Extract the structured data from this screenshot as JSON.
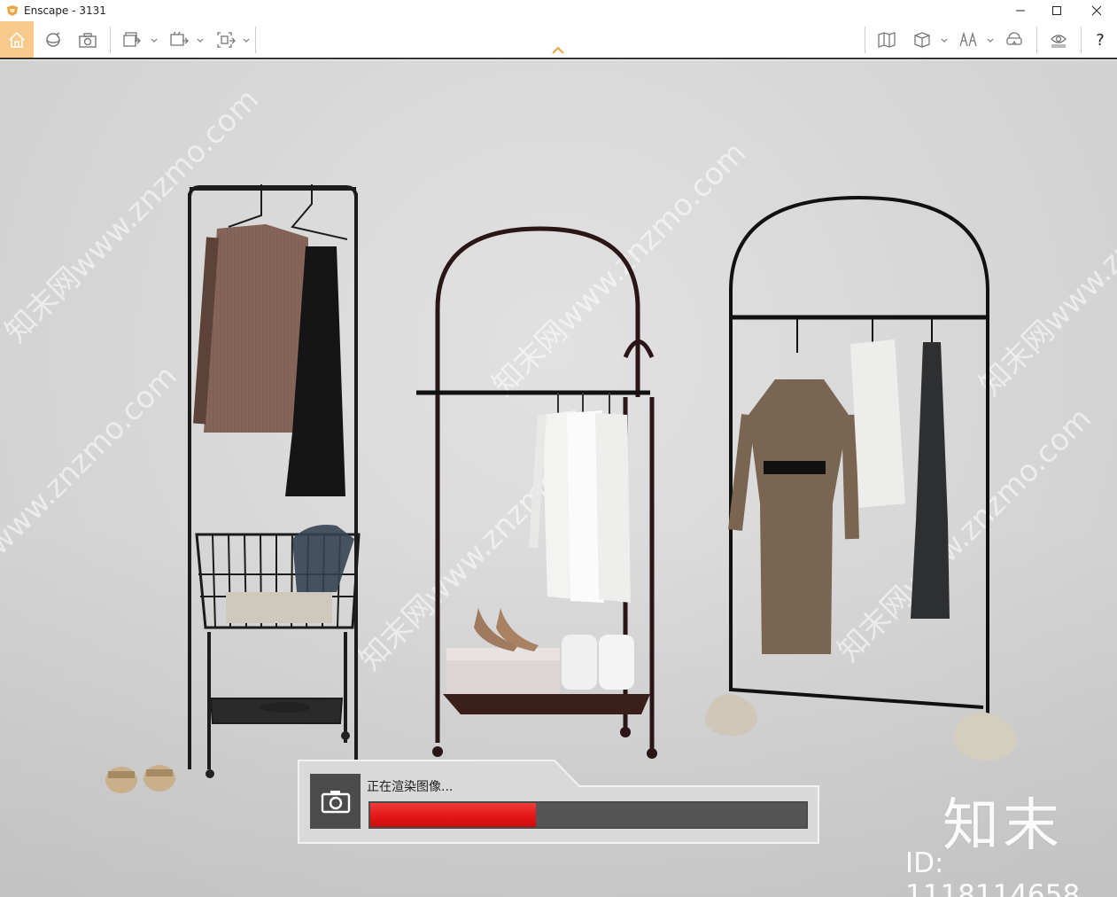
{
  "window": {
    "title": "Enscape - 3131",
    "controls": [
      "minimize-icon",
      "maximize-icon",
      "close-icon"
    ]
  },
  "toolbar": {
    "left_tools": [
      "home-icon",
      "orbit-icon",
      "screenshot-icon",
      "batch-render-icon",
      "video-export-icon",
      "panorama-export-icon"
    ],
    "right_tools": [
      "map-icon",
      "asset-library-icon",
      "views-icon",
      "vr-headset-icon",
      "visual-settings-icon"
    ],
    "help_label": "?",
    "home_active_color": "#f8c98a"
  },
  "viewport": {
    "watermark_logo": "知末",
    "watermark_id": "ID: 1118114658",
    "watermark_text": "知末网www.znzmo.com"
  },
  "render_dialog": {
    "status_text": "正在渲染图像...",
    "progress": 0.38,
    "progress_color": "#e31414",
    "icon": "camera-icon"
  }
}
